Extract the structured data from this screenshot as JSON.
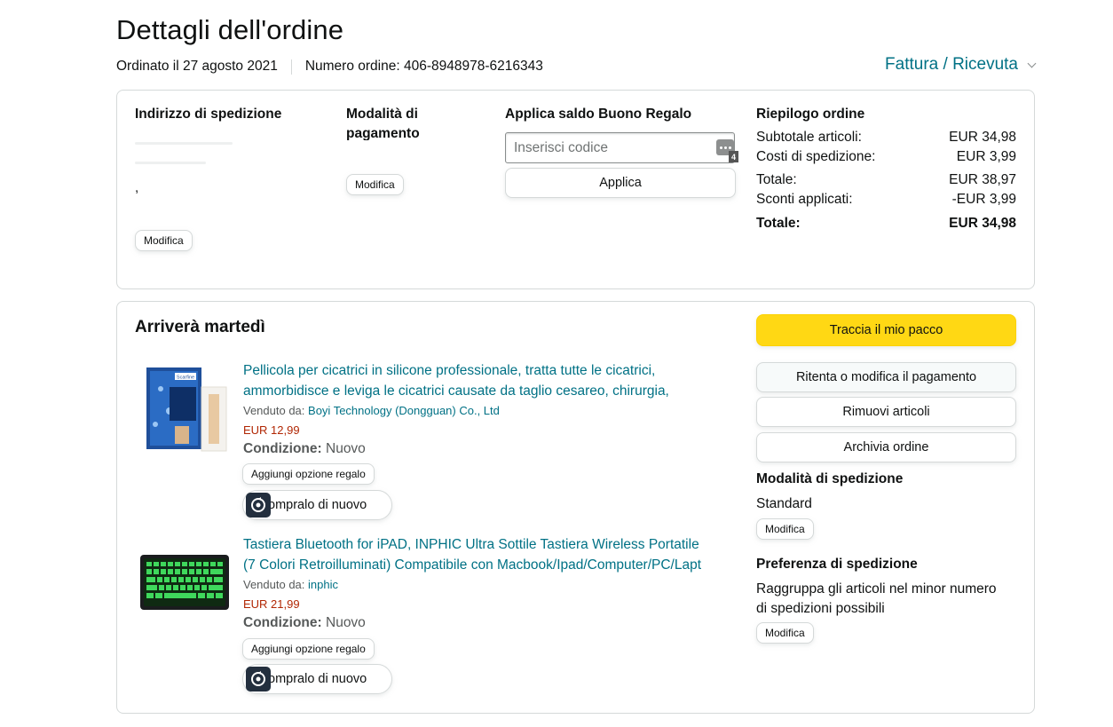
{
  "page": {
    "title": "Dettagli dell'ordine",
    "ordered_label": "Ordinato il 27 agosto 2021",
    "order_number_label": "Numero ordine: 406-8948978-6216343",
    "invoice_link": "Fattura / Ricevuta"
  },
  "summary_box": {
    "shipping_address": {
      "heading": "Indirizzo di spedizione",
      "line_dot": ",",
      "edit_label": "Modifica"
    },
    "payment": {
      "heading": "Modalità di pagamento",
      "edit_label": "Modifica"
    },
    "gift": {
      "heading": "Applica saldo Buono Regalo",
      "placeholder": "Inserisci codice",
      "badge_count": "4",
      "apply_label": "Applica"
    },
    "order_summary": {
      "heading": "Riepilogo ordine",
      "rows": [
        {
          "label": "Subtotale articoli:",
          "value": "EUR 34,98"
        },
        {
          "label": "Costi di spedizione:",
          "value": "EUR 3,99"
        },
        {
          "label": "Totale:",
          "value": "EUR 38,97"
        },
        {
          "label": "Sconti applicati:",
          "value": "-EUR 3,99"
        }
      ],
      "grand_total": {
        "label": "Totale:",
        "value": "EUR 34,98"
      }
    }
  },
  "shipment": {
    "heading": "Arriverà martedì",
    "items": [
      {
        "title_line1": "Pellicola per cicatrici in silicone professionale, tratta tutte le cicatrici,",
        "title_line2": "ammorbidisce e leviga le cicatrici causate da taglio cesareo, chirurgia,",
        "sold_by_label": "Venduto da:",
        "seller": "Boyi Technology (Dongguan) Co., Ltd",
        "price": "EUR 12,99",
        "condition_label": "Condizione:",
        "condition_value": "Nuovo",
        "gift_option_label": "Aggiungi opzione regalo",
        "buy_again_label": "ompralo di nuovo",
        "image_brand": "Scarfine"
      },
      {
        "title_line1": "Tastiera Bluetooth for iPAD, INPHIC Ultra Sottile Tastiera Wireless Portatile",
        "title_line2": "(7 Colori Retroilluminati) Compatibile con Macbook/Ipad/Computer/PC/Lapt",
        "sold_by_label": "Venduto da:",
        "seller": "inphic",
        "price": "EUR 21,99",
        "condition_label": "Condizione:",
        "condition_value": "Nuovo",
        "gift_option_label": "Aggiungi opzione regalo",
        "buy_again_label": "ompralo di nuovo"
      }
    ],
    "actions": {
      "track": "Traccia il mio pacco",
      "retry_payment": "Ritenta o modifica il pagamento",
      "remove_items": "Rimuovi articoli",
      "archive": "Archivia ordine"
    },
    "shipping_method": {
      "heading": "Modalità di spedizione",
      "value": "Standard",
      "edit_label": "Modifica"
    },
    "shipping_preference": {
      "heading": "Preferenza di spedizione",
      "value_line1": "Raggruppa gli articoli nel minor numero",
      "value_line2": "di spedizioni possibili",
      "edit_label": "Modifica"
    }
  },
  "colors": {
    "link": "#007185",
    "price": "#b12704",
    "primary_button": "#ffd814",
    "border": "#d5d9d9"
  }
}
